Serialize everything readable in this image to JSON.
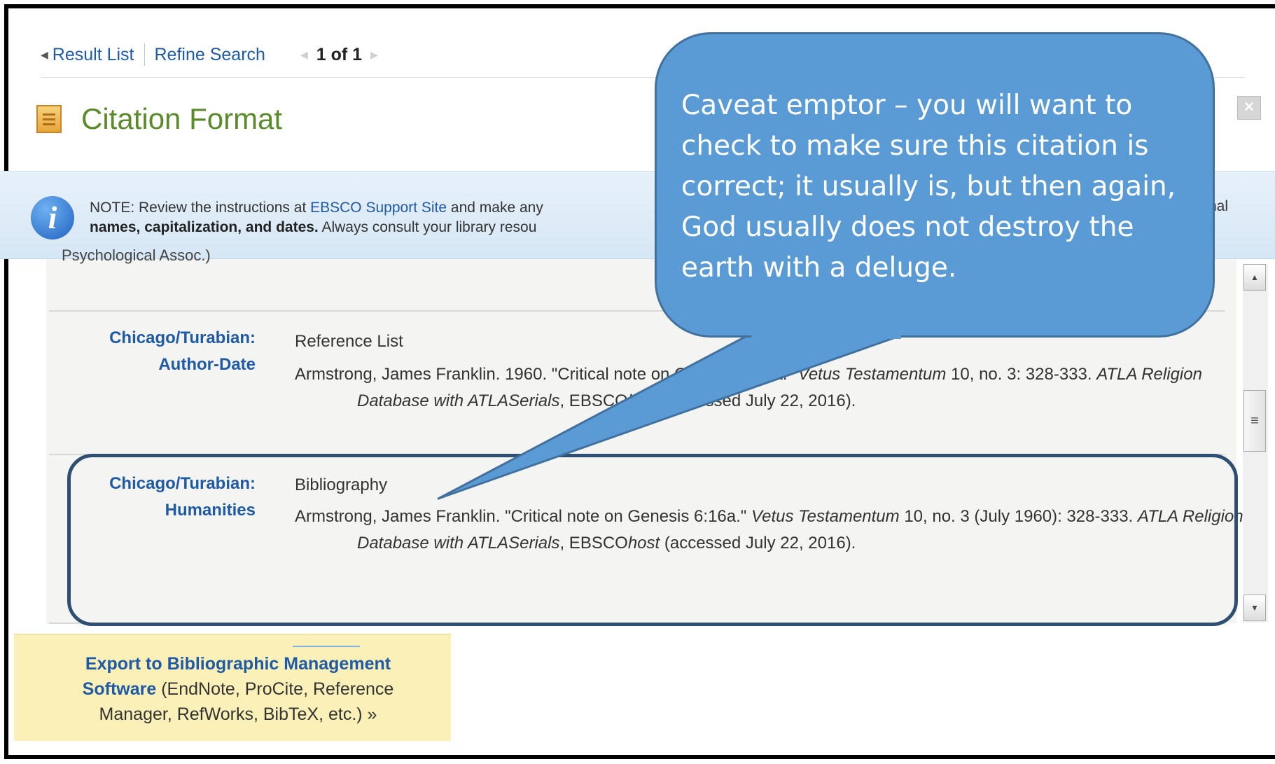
{
  "topnav": {
    "result_list": "Result List",
    "refine_search": "Refine Search",
    "pager": "1 of 1"
  },
  "page_title": "Citation Format",
  "note": {
    "prefix": "NOTE: Review the instructions at ",
    "link": "EBSCO Support Site",
    "after_link": " and make any",
    "bold": "names, capitalization, and dates.",
    "line2_rest": " Always consult your library resou",
    "right_fragment": "nal"
  },
  "cut_text": "Psychological Assoc.)",
  "citations": [
    {
      "label_line1": "Chicago/Turabian:",
      "label_line2": "Author-Date",
      "heading": "Reference List",
      "text_a": "Armstrong, James Franklin. 1960. \"Critical note on Genesis 6:16a.\" ",
      "journal": "Vetus Testamentum",
      "text_b": " 10, no. 3: 328-333. ",
      "database": "ATLA Religion Database with ATLASerials",
      "text_c": ", EBSCO",
      "host": "host",
      "text_d": " (accessed July 22, 2016)."
    },
    {
      "label_line1": "Chicago/Turabian:",
      "label_line2": "Humanities",
      "heading": "Bibliography",
      "text_a": "Armstrong, James Franklin. \"Critical note on Genesis 6:16a.\" ",
      "journal": "Vetus Testamentum",
      "text_b": " 10, no. 3 (July 1960): 328-333. ",
      "database": "ATLA Religion Database with ATLASerials",
      "text_c": ", EBSCO",
      "host": "host",
      "text_d": " (accessed July 22, 2016)."
    }
  ],
  "export": {
    "link": "Export to Bibliographic Management Software",
    "rest": " (EndNote, ProCite, Reference Manager, RefWorks, BibTeX, etc.) »"
  },
  "callout": {
    "text": "Caveat emptor – you will want to check to make sure this citation is correct; it usually is, but then again, God usually does not destroy the earth with a deluge."
  },
  "colors": {
    "link": "#1f5aa6",
    "title_green": "#5b8a2b",
    "callout_fill": "#5b9bd5",
    "highlight_border": "#2f4f72",
    "export_bg": "#fbf1b8"
  }
}
